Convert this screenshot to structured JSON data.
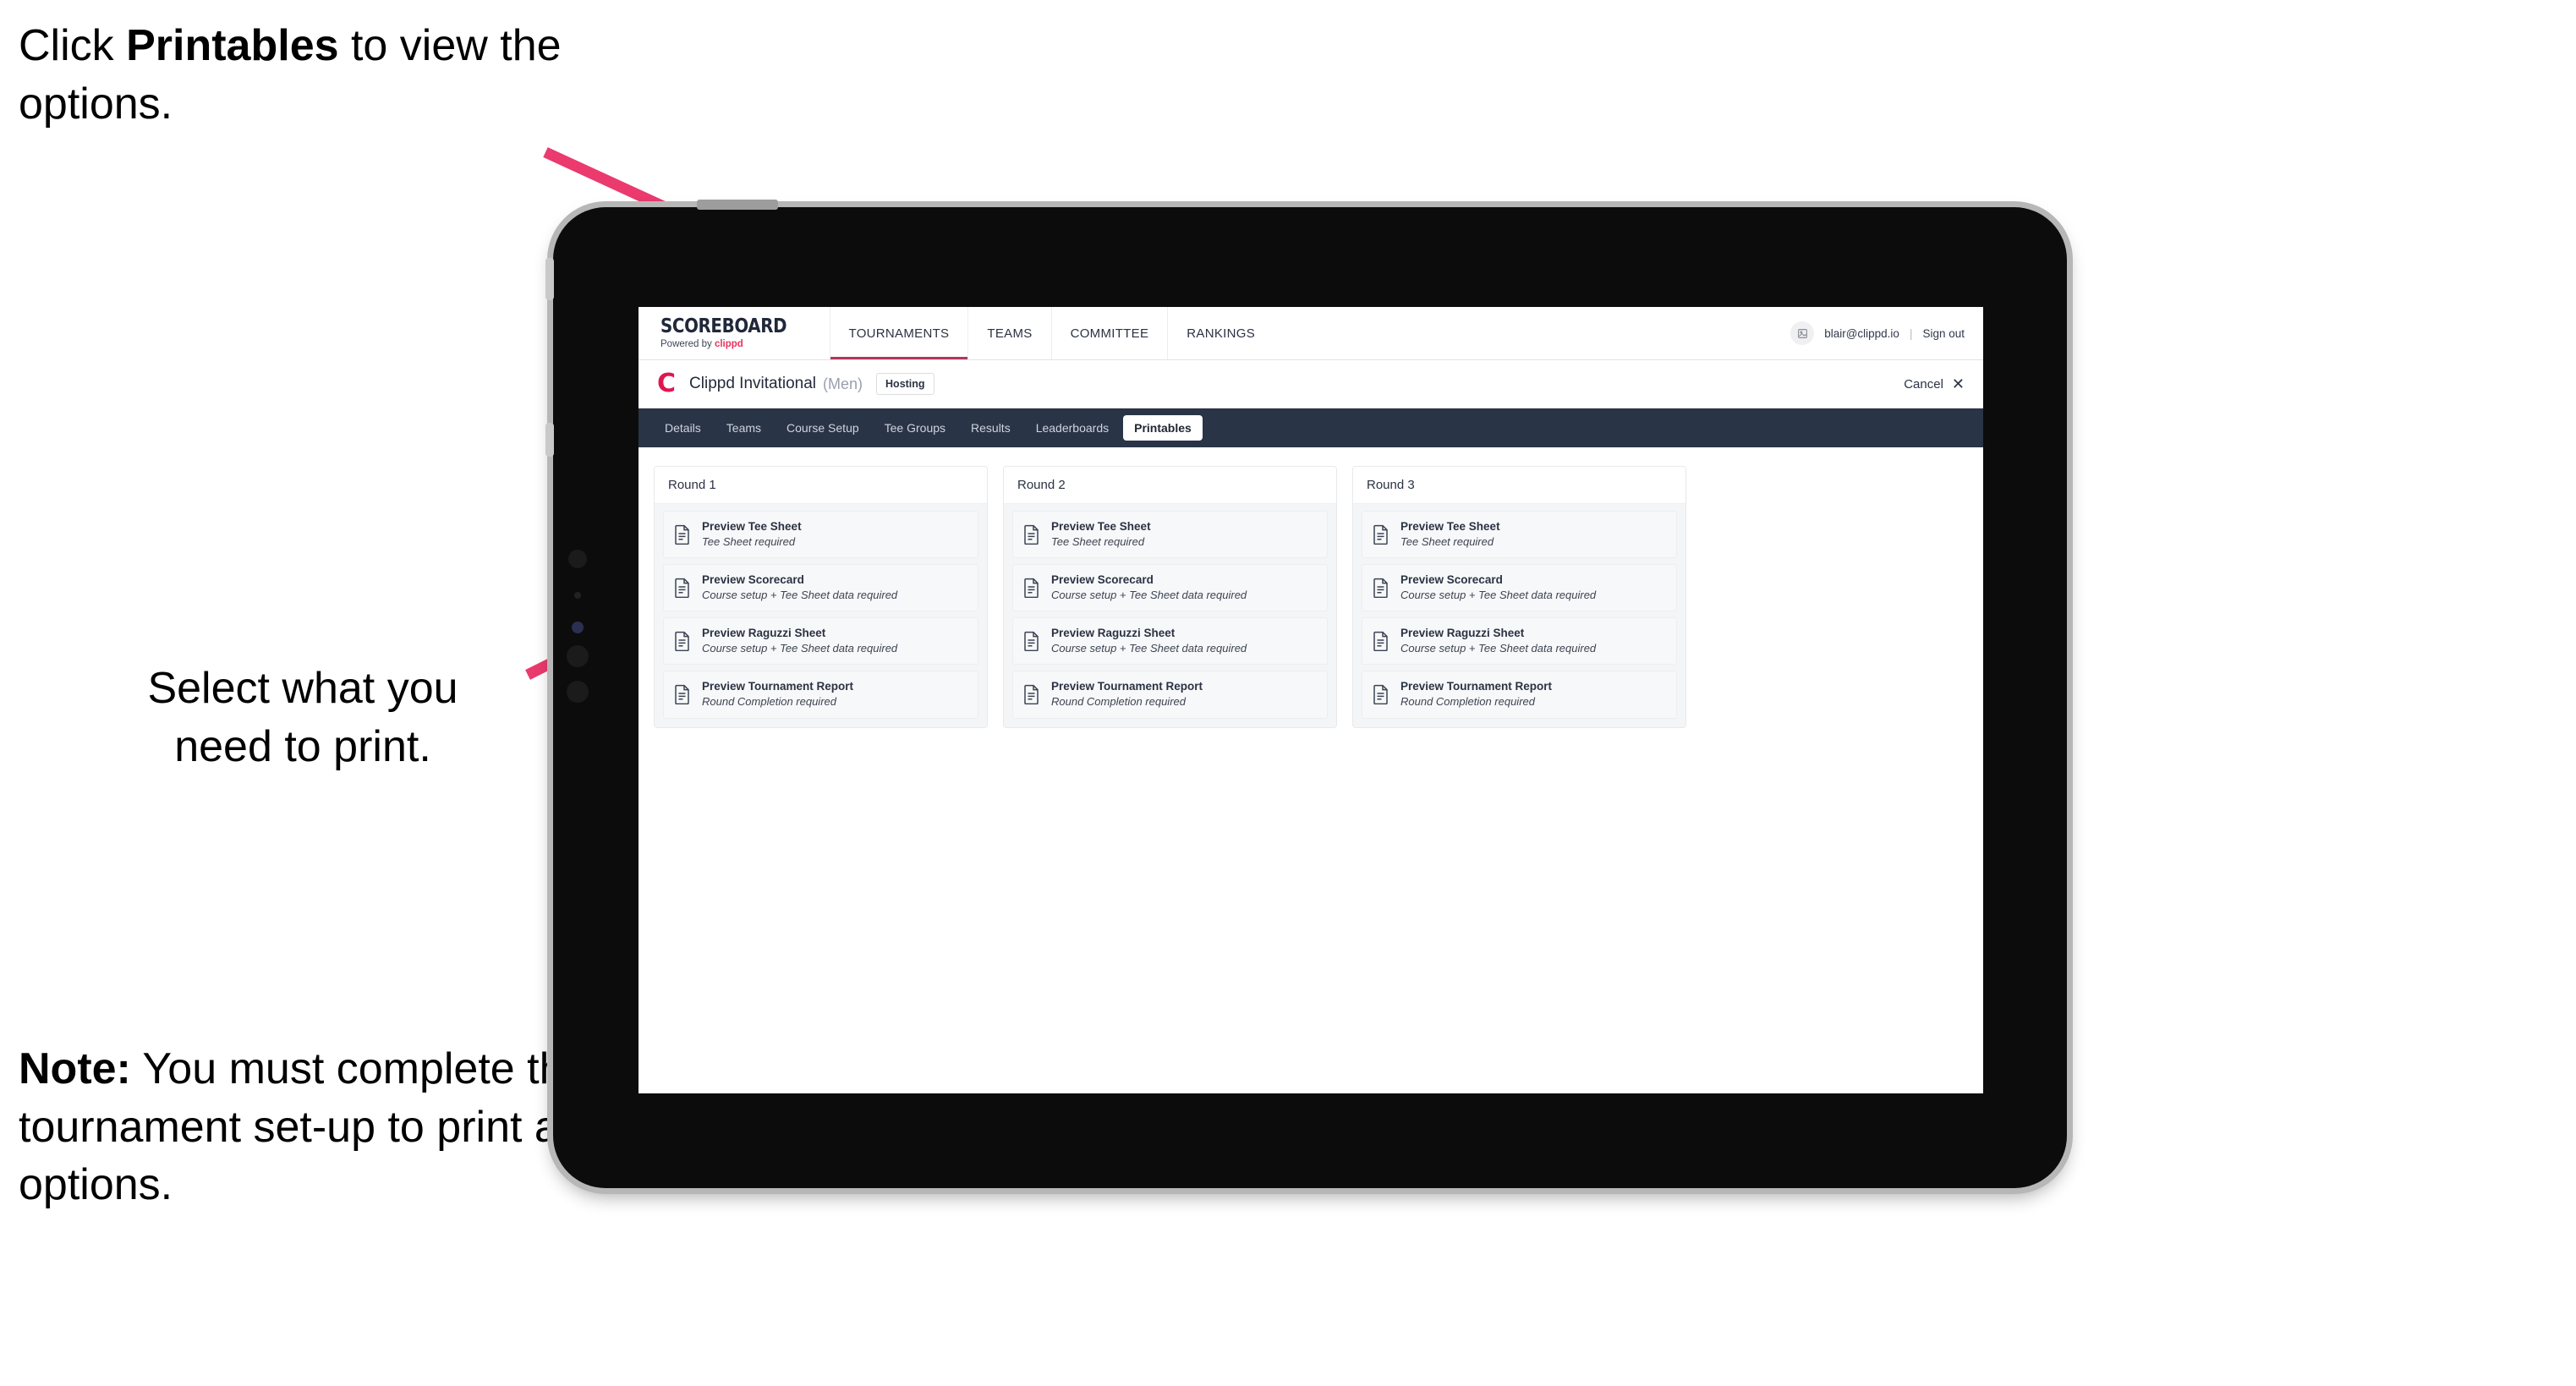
{
  "annotations": {
    "top": {
      "prefix": "Click ",
      "bold": "Printables",
      "suffix": " to view the options."
    },
    "middle": "Select what you\nneed to print.",
    "note": {
      "bold": "Note:",
      "text": " You must complete the tournament set-up to print all the options."
    }
  },
  "device": {
    "type": "tablet"
  },
  "app": {
    "brand": {
      "title": "SCOREBOARD",
      "subtitle_prefix": "Powered by ",
      "subtitle_accent": "clippd"
    },
    "topnav": [
      {
        "label": "TOURNAMENTS",
        "active": true
      },
      {
        "label": "TEAMS",
        "active": false
      },
      {
        "label": "COMMITTEE",
        "active": false
      },
      {
        "label": "RANKINGS",
        "active": false
      }
    ],
    "user": {
      "avatar_icon": "user-avatar-icon",
      "email": "blair@clippd.io",
      "separator": "|",
      "signout_label": "Sign out"
    },
    "tournament_bar": {
      "logo_letter": "C",
      "name": "Clippd Invitational",
      "gender": "(Men)",
      "badge": "Hosting",
      "cancel_label": "Cancel",
      "cancel_icon": "close-x-icon"
    },
    "section_nav": [
      {
        "label": "Details",
        "active": false
      },
      {
        "label": "Teams",
        "active": false
      },
      {
        "label": "Course Setup",
        "active": false
      },
      {
        "label": "Tee Groups",
        "active": false
      },
      {
        "label": "Results",
        "active": false
      },
      {
        "label": "Leaderboards",
        "active": false
      },
      {
        "label": "Printables",
        "active": true
      }
    ],
    "rounds": [
      {
        "title": "Round 1",
        "items": [
          {
            "title": "Preview Tee Sheet",
            "requirement": "Tee Sheet required"
          },
          {
            "title": "Preview Scorecard",
            "requirement": "Course setup + Tee Sheet data required"
          },
          {
            "title": "Preview Raguzzi Sheet",
            "requirement": "Course setup + Tee Sheet data required"
          },
          {
            "title": "Preview Tournament Report",
            "requirement": "Round Completion required"
          }
        ]
      },
      {
        "title": "Round 2",
        "items": [
          {
            "title": "Preview Tee Sheet",
            "requirement": "Tee Sheet required"
          },
          {
            "title": "Preview Scorecard",
            "requirement": "Course setup + Tee Sheet data required"
          },
          {
            "title": "Preview Raguzzi Sheet",
            "requirement": "Course setup + Tee Sheet data required"
          },
          {
            "title": "Preview Tournament Report",
            "requirement": "Round Completion required"
          }
        ]
      },
      {
        "title": "Round 3",
        "items": [
          {
            "title": "Preview Tee Sheet",
            "requirement": "Tee Sheet required"
          },
          {
            "title": "Preview Scorecard",
            "requirement": "Course setup + Tee Sheet data required"
          },
          {
            "title": "Preview Raguzzi Sheet",
            "requirement": "Course setup + Tee Sheet data required"
          },
          {
            "title": "Preview Tournament Report",
            "requirement": "Round Completion required"
          }
        ]
      }
    ]
  },
  "colors": {
    "accent_pink": "#e4345c",
    "nav_dark": "#2a3447",
    "brand_red": "#e0164f",
    "arrow_pink": "#ea3a6e"
  }
}
